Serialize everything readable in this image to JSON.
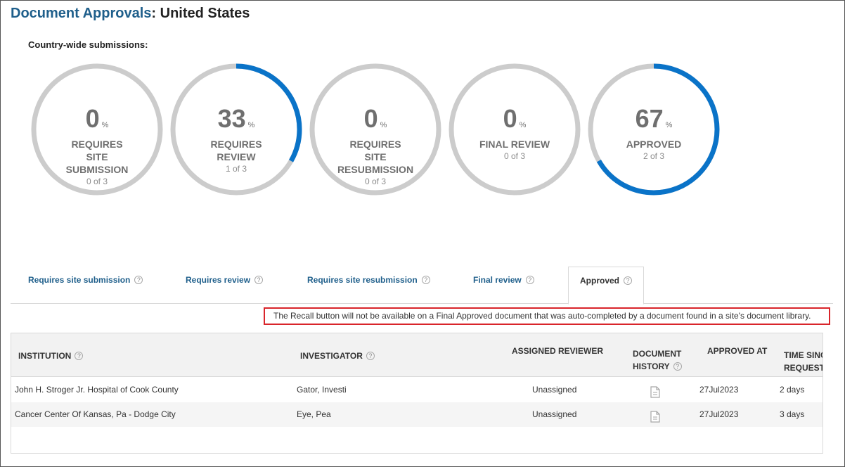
{
  "page": {
    "title_prefix": "Document Approvals",
    "title_suffix": ": United States",
    "subheading": "Country-wide submissions:"
  },
  "colors": {
    "title_blue": "#1f5f8b",
    "ring_track": "#cccccc",
    "ring_progress": "#0a73c8",
    "notice_border": "#d9252b"
  },
  "stats": [
    {
      "value": "0",
      "unit": "%",
      "label": [
        "REQUIRES",
        "SITE",
        "SUBMISSION"
      ],
      "count": "0 of 3",
      "fraction": 0.0
    },
    {
      "value": "33",
      "unit": "%",
      "label": [
        "REQUIRES",
        "REVIEW"
      ],
      "count": "1 of 3",
      "fraction": 0.333
    },
    {
      "value": "0",
      "unit": "%",
      "label": [
        "REQUIRES",
        "SITE",
        "RESUBMISSION"
      ],
      "count": "0 of 3",
      "fraction": 0.0
    },
    {
      "value": "0",
      "unit": "%",
      "label": [
        "FINAL REVIEW"
      ],
      "count": "0 of 3",
      "fraction": 0.0
    },
    {
      "value": "67",
      "unit": "%",
      "label": [
        "APPROVED"
      ],
      "count": "2 of 3",
      "fraction": 0.667
    }
  ],
  "tabs": [
    {
      "label": "Requires site submission",
      "help": "?"
    },
    {
      "label": "Requires review",
      "help": "?"
    },
    {
      "label": "Requires site resubmission",
      "help": "?"
    },
    {
      "label": "Final review",
      "help": "?"
    },
    {
      "label": "Approved",
      "help": "?",
      "active": true
    }
  ],
  "notice": "The Recall button will not be available on a Final Approved document that was auto-completed by a document found in a site's document library.",
  "table": {
    "headers": {
      "institution": "INSTITUTION",
      "investigator": "INVESTIGATOR",
      "assigned_reviewer": "ASSIGNED REVIEWER",
      "document_history_1": "DOCUMENT",
      "document_history_2": "HISTORY",
      "approved_at": "APPROVED AT",
      "time_since_1": "TIME SINC",
      "time_since_2": "REQUEST",
      "help": "?"
    },
    "rows": [
      {
        "institution": "John H. Stroger Jr. Hospital of Cook County",
        "investigator": "Gator, Investi",
        "reviewer": "Unassigned",
        "doc_icon": "document-icon",
        "approved_at": "27Jul2023",
        "time_since": "2 days"
      },
      {
        "institution": "Cancer Center Of Kansas, Pa - Dodge City",
        "investigator": "Eye, Pea",
        "reviewer": "Unassigned",
        "doc_icon": "document-icon",
        "approved_at": "27Jul2023",
        "time_since": "3 days"
      }
    ]
  }
}
